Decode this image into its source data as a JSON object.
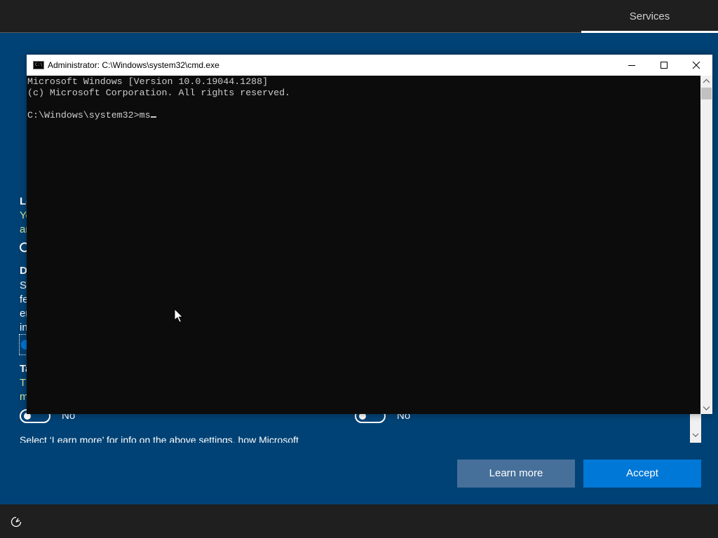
{
  "top_bar": {
    "tab_label": "Services"
  },
  "oobe": {
    "partial_lines": [
      {
        "text": "Lo",
        "style": "bold"
      },
      {
        "text": "Yo",
        "style": "yellow"
      },
      {
        "text": "ar",
        "style": "yellow"
      },
      {
        "text": "D",
        "style": "bold"
      },
      {
        "text": "Se",
        "style": "normal"
      },
      {
        "text": "fe",
        "style": "normal"
      },
      {
        "text": "er",
        "style": "normal"
      },
      {
        "text": "in",
        "style": "normal"
      },
      {
        "text": "Ta",
        "style": "bold"
      },
      {
        "text": "Th",
        "style": "yellow"
      },
      {
        "text": "m",
        "style": "yellow"
      }
    ],
    "toggle_left_label": "No",
    "toggle_right_label": "No",
    "footer_text": "Select ‘Learn more’ for info on the above settings, how Microsoft",
    "learn_more_label": "Learn more",
    "accept_label": "Accept"
  },
  "cmd_window": {
    "title": "Administrator: C:\\Windows\\system32\\cmd.exe",
    "console_lines": [
      "Microsoft Windows [Version 10.0.19044.1288]",
      "(c) Microsoft Corporation. All rights reserved.",
      "",
      "C:\\Windows\\system32>ms"
    ]
  },
  "colors": {
    "oobe_background": "#004275",
    "accent": "#0078d7",
    "console_background": "#0c0c0c",
    "console_text": "#cccccc"
  }
}
